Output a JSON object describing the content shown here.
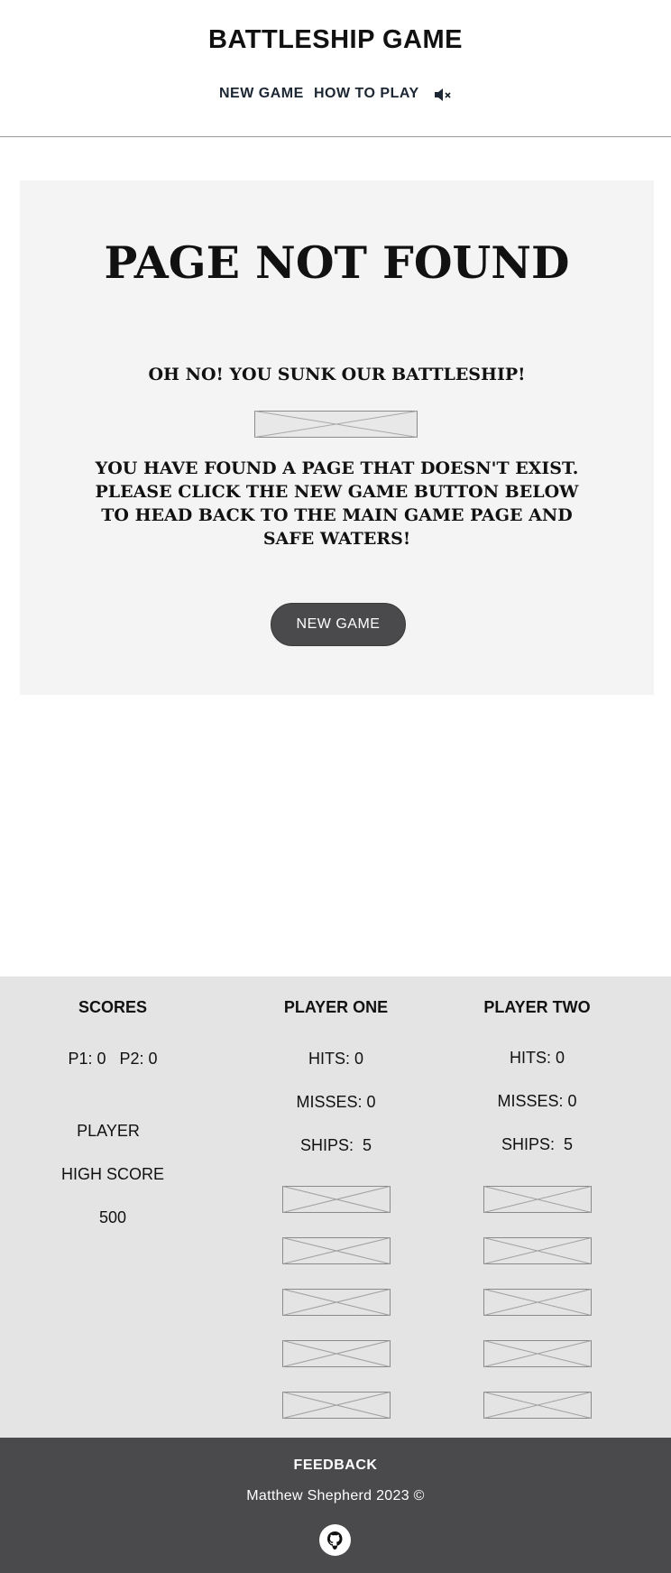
{
  "header": {
    "title": "BATTLESHIP GAME",
    "nav": {
      "new_game": "NEW GAME",
      "how_to_play": "HOW TO PLAY",
      "mute_icon": "speaker-muted-icon"
    }
  },
  "error": {
    "title": "PAGE NOT FOUND",
    "subtitle": "OH NO! YOU SUNK OUR BATTLESHIP!",
    "message": "YOU HAVE FOUND A PAGE THAT DOESN'T EXIST. PLEASE CLICK THE NEW GAME BUTTON BELOW TO HEAD BACK TO THE MAIN GAME PAGE AND SAFE WATERS!",
    "button": "NEW GAME"
  },
  "scores": {
    "heading": "SCORES",
    "tally": "P1: 0   P2: 0",
    "player_label": "PLAYER",
    "high_score_label": "HIGH SCORE",
    "high_score": "500"
  },
  "player_one": {
    "heading": "PLAYER ONE",
    "hits": "HITS: 0",
    "misses": "MISSES: 0",
    "ships": "SHIPS:  5"
  },
  "player_two": {
    "heading": "PLAYER TWO",
    "hits": "HITS: 0",
    "misses": "MISSES: 0",
    "ships": "SHIPS:  5"
  },
  "footer": {
    "feedback": "FEEDBACK",
    "copyright": "Matthew Shepherd 2023  ©",
    "github_icon": "github-icon"
  },
  "colors": {
    "button_bg": "#4a4a4c",
    "card_bg": "#f4f4f4",
    "scoreboard_bg": "#e4e4e4",
    "footer_bg": "#4a4a4c"
  }
}
